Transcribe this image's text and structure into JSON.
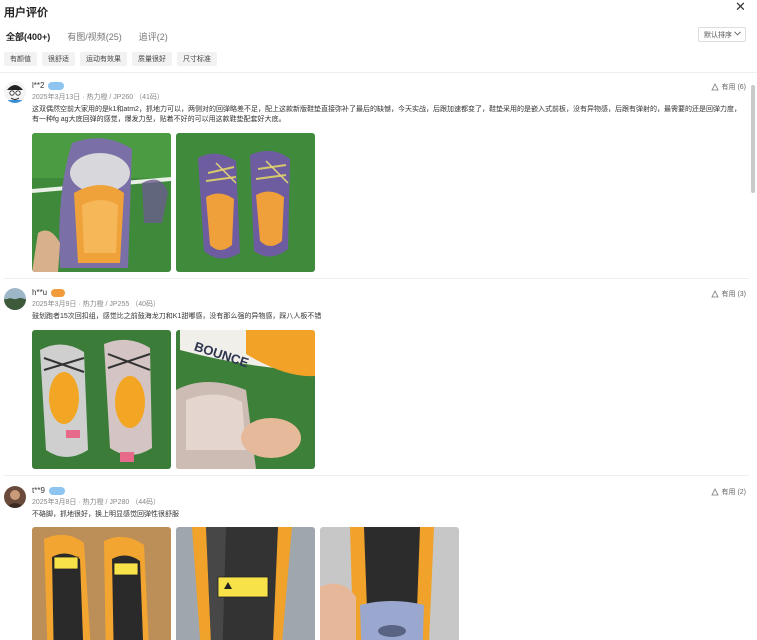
{
  "header": {
    "title": "用户评价",
    "close_icon": "close-icon"
  },
  "tabs": [
    {
      "label": "全部(400+)",
      "active": true
    },
    {
      "label": "有图/视频(25)",
      "active": false
    },
    {
      "label": "追评(2)",
      "active": false
    }
  ],
  "sort": {
    "label": "默认排序",
    "icon": "chevron-down-icon"
  },
  "tags": [
    {
      "label": "有颜值"
    },
    {
      "label": "很舒适"
    },
    {
      "label": "运动有效果"
    },
    {
      "label": "质量很好"
    },
    {
      "label": "尺寸标准"
    }
  ],
  "reviews": [
    {
      "user": "l**2",
      "date_line": "2025年3月13日 · 热力橙 / JP260 （41码）",
      "useful": "有用 (6)",
      "content": "这双偶然空前大家用的是k1和atm2，抓地力可以，两侧对的回弹略差不足，配上这款新版鞋垫直接弥补了最后的缺憾，今天实战，后跟加速都变了，鞋垫采用的是嵌入式前板，没有异物感，后跟有弹射的，最需要的还是回弹力度，有一种fg ag大底回弹的感觉，爆发力型，贴着不好的可以用这款鞋垫配套好大底。",
      "badge_color": "#8ec5f0"
    },
    {
      "user": "h**u",
      "date_line": "2025年3月9日 · 热力橙 / JP255 （40码）",
      "useful": "有用 (3)",
      "content": "鼓划跑者15次回扣组，感觉比之前鼓海龙刀和K1甜嘟感，没有那么强的异物感，踩八人板不错",
      "badge_color": "#f29b3a"
    },
    {
      "user": "t**9",
      "date_line": "2025年3月8日 · 热力橙 / JP280 （44码）",
      "useful": "有用 (2)",
      "content": "不硌脚，抓地很好，换上明显感觉回弹性很舒服",
      "badge_color": "#8ec5f0"
    }
  ],
  "photo_text": {
    "brand": "BOUNCE"
  }
}
